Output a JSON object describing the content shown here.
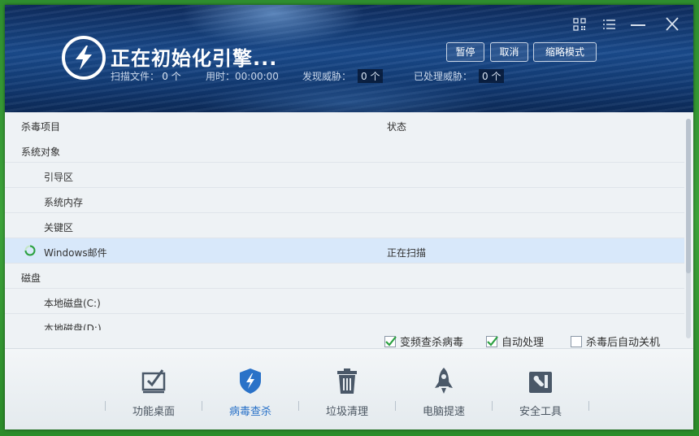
{
  "header": {
    "title": "正在初始化引擎...",
    "stats": {
      "scanned_label": "扫描文件：",
      "scanned_value": "0 个",
      "time_label": "用时：",
      "time_value": "00:00:00",
      "threats_label": "发现威胁：",
      "threats_value": "0 个",
      "handled_label": "已处理威胁：",
      "handled_value": "0 个"
    },
    "buttons": {
      "pause": "暂停",
      "cancel": "取消",
      "compact": "缩略模式"
    }
  },
  "window_controls": [
    "qr-code-icon",
    "menu-icon",
    "minimize-icon",
    "close-icon"
  ],
  "table": {
    "columns": {
      "item": "杀毒项目",
      "status": "状态"
    },
    "rows": [
      {
        "label": "系统对象",
        "status": "",
        "indent": 0,
        "selected": false
      },
      {
        "label": "引导区",
        "status": "",
        "indent": 1,
        "selected": false
      },
      {
        "label": "系统内存",
        "status": "",
        "indent": 1,
        "selected": false
      },
      {
        "label": "关键区",
        "status": "",
        "indent": 1,
        "selected": false
      },
      {
        "label": "Windows邮件",
        "status": "正在扫描",
        "indent": 1,
        "selected": true,
        "spinner": true
      },
      {
        "label": "磁盘",
        "status": "",
        "indent": 0,
        "selected": false
      },
      {
        "label": "本地磁盘(C:)",
        "status": "",
        "indent": 1,
        "selected": false
      },
      {
        "label": "本地磁盘(D:)",
        "status": "",
        "indent": 1,
        "selected": false
      }
    ]
  },
  "options": {
    "variable_freq": {
      "label": "变频查杀病毒",
      "checked": true
    },
    "auto_handle": {
      "label": "自动处理",
      "checked": true
    },
    "auto_shutdown": {
      "label": "杀毒后自动关机",
      "checked": false
    }
  },
  "nav": {
    "items": [
      {
        "label": "功能桌面",
        "icon": "desktop-check-icon",
        "active": false
      },
      {
        "label": "病毒查杀",
        "icon": "shield-bolt-icon",
        "active": true
      },
      {
        "label": "垃圾清理",
        "icon": "trash-icon",
        "active": false
      },
      {
        "label": "电脑提速",
        "icon": "rocket-icon",
        "active": false
      },
      {
        "label": "安全工具",
        "icon": "toolbox-icon",
        "active": false
      }
    ]
  },
  "colors": {
    "accent": "#2a72c8",
    "check": "#2aa040",
    "header_bg": "#123a73"
  }
}
